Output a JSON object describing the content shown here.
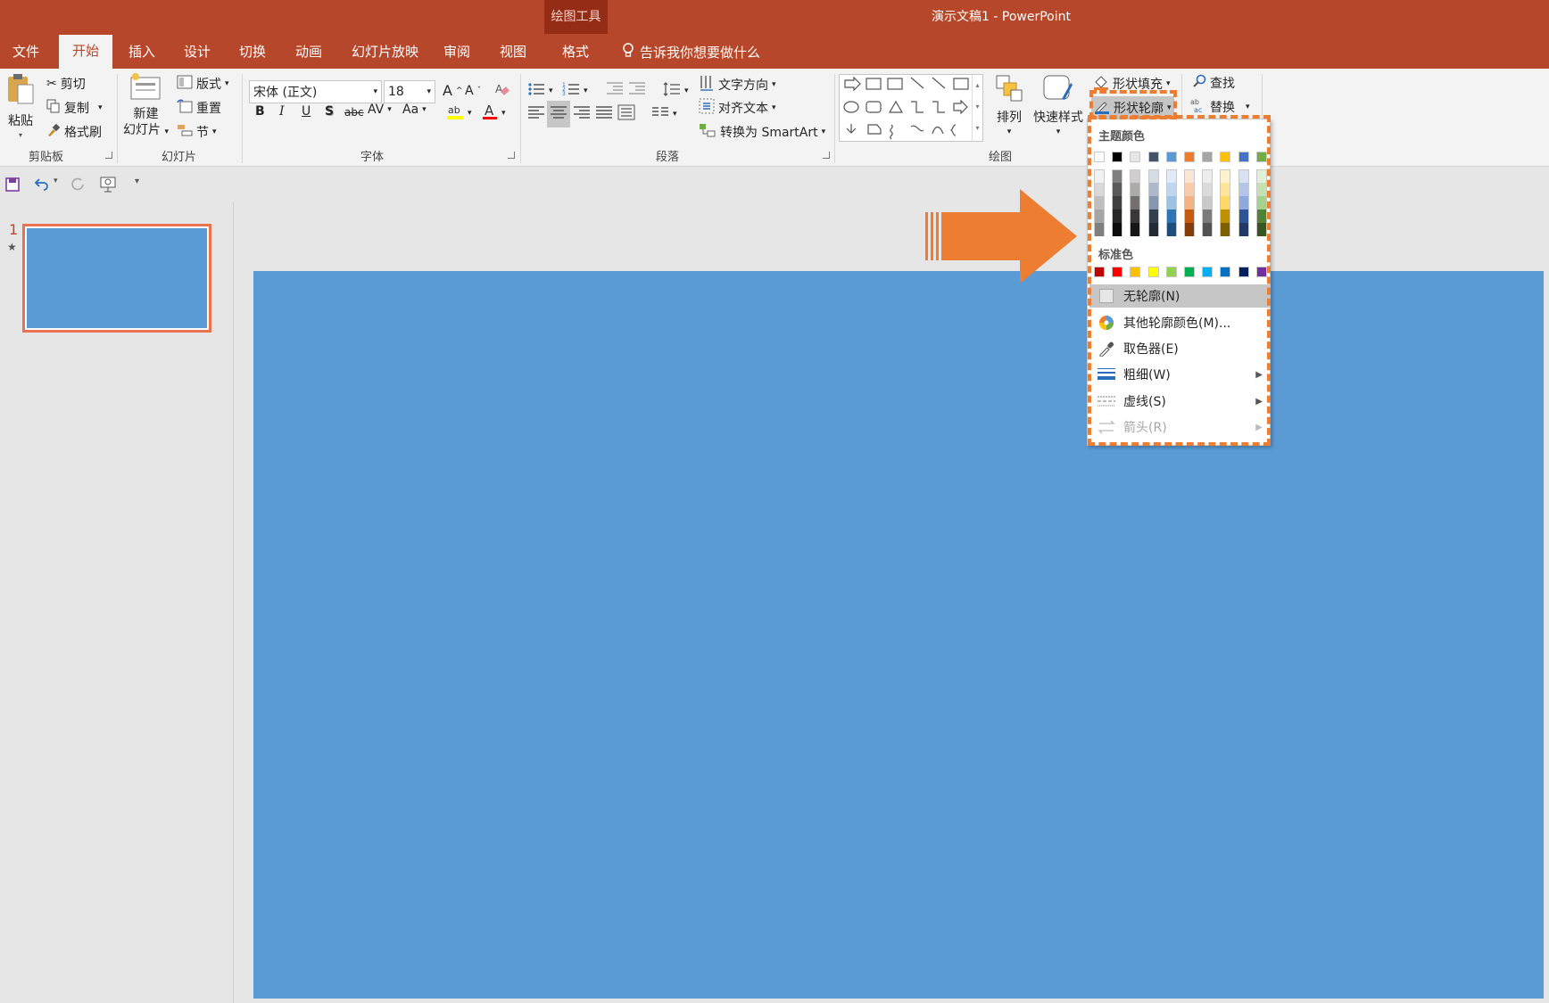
{
  "titlebar": {
    "tools_label": "绘图工具",
    "app_title": "演示文稿1 - PowerPoint"
  },
  "tabs": {
    "file": "文件",
    "home": "开始",
    "insert": "插入",
    "design": "设计",
    "transitions": "切换",
    "animations": "动画",
    "slideshow": "幻灯片放映",
    "review": "审阅",
    "view": "视图",
    "format": "格式",
    "tellme": "告诉我你想要做什么"
  },
  "clipboard": {
    "paste": "粘贴",
    "cut": "剪切",
    "copy": "复制",
    "format_painter": "格式刷",
    "label": "剪贴板"
  },
  "slides": {
    "new_line1": "新建",
    "new_line2": "幻灯片",
    "layout": "版式",
    "reset": "重置",
    "section": "节",
    "label": "幻灯片"
  },
  "font": {
    "name": "宋体 (正文)",
    "size": "18",
    "bold": "B",
    "italic": "I",
    "underline": "U",
    "shadow": "S",
    "strike": "abc",
    "spacing": "AV",
    "case": "Aa",
    "label": "字体"
  },
  "paragraph": {
    "text_direction": "文字方向",
    "align_text": "对齐文本",
    "smartart": "转换为 SmartArt",
    "label": "段落"
  },
  "drawing": {
    "arrange": "排列",
    "quick_styles": "快速样式",
    "shape_fill": "形状填充",
    "shape_outline": "形状轮廓",
    "label": "绘图"
  },
  "editing": {
    "find": "查找",
    "replace": "替换"
  },
  "outline_menu": {
    "theme_colors_heading": "主题颜色",
    "standard_colors_heading": "标准色",
    "no_outline": "无轮廓(N)",
    "more_colors": "其他轮廓颜色(M)...",
    "eyedropper": "取色器(E)",
    "weight": "粗细(W)",
    "dashes": "虚线(S)",
    "arrows": "箭头(R)",
    "theme_top": [
      "#ffffff",
      "#000000",
      "#e7e6e6",
      "#44546a",
      "#5b9bd5",
      "#ed7d31",
      "#a5a5a5",
      "#ffc000",
      "#4472c4",
      "#70ad47"
    ],
    "theme_shades": [
      [
        "#f2f2f2",
        "#7f7f7f",
        "#d0cece",
        "#d6dce4",
        "#deebf6",
        "#fbe5d5",
        "#ededed",
        "#fff2cc",
        "#d9e2f3",
        "#e2efd9"
      ],
      [
        "#d8d8d8",
        "#595959",
        "#aeabab",
        "#adb9ca",
        "#bdd7ee",
        "#f7cbac",
        "#dbdbdb",
        "#fee599",
        "#b4c6e7",
        "#c5e0b3"
      ],
      [
        "#bfbfbf",
        "#3f3f3f",
        "#757070",
        "#8496b0",
        "#9cc3e5",
        "#f4b183",
        "#c9c9c9",
        "#ffd965",
        "#8eaadb",
        "#a8d08d"
      ],
      [
        "#a5a5a5",
        "#262626",
        "#3a3838",
        "#323f4f",
        "#2e75b5",
        "#c55a11",
        "#7b7b7b",
        "#bf9000",
        "#2f5496",
        "#538135"
      ],
      [
        "#7f7f7f",
        "#0c0c0c",
        "#171616",
        "#222a35",
        "#1e4e79",
        "#843c0b",
        "#525252",
        "#7f6000",
        "#1f3864",
        "#375623"
      ]
    ],
    "standard": [
      "#c00000",
      "#ff0000",
      "#ffc000",
      "#ffff00",
      "#92d050",
      "#00b050",
      "#00b0f0",
      "#0070c0",
      "#002060",
      "#7030a0"
    ]
  },
  "slide_panel": {
    "slide_number": "1",
    "star": "★"
  },
  "colors": {
    "accent": "#b7472a",
    "slide_fill": "#5b9bd5",
    "highlight_dash": "#ed7d31",
    "arrow": "#ed7d31"
  }
}
